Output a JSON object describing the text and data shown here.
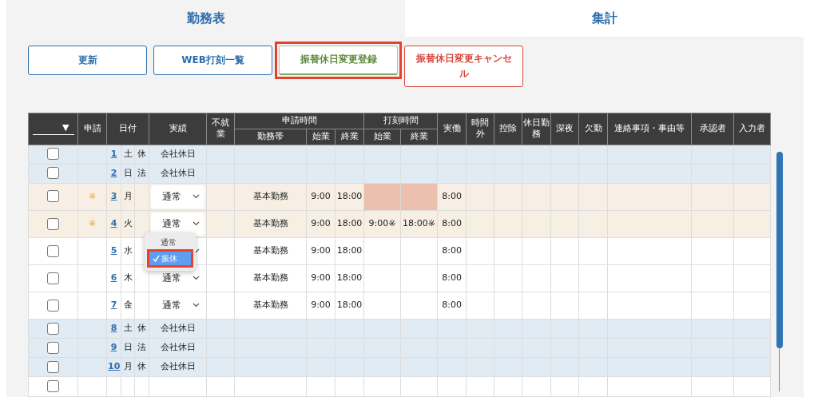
{
  "tabs": [
    {
      "label": "勤務表",
      "selected": true
    },
    {
      "label": "集計",
      "selected": false
    }
  ],
  "buttons": [
    {
      "label": "更新",
      "kind": "primary",
      "highlighted": false
    },
    {
      "label": "WEB打刻一覧",
      "kind": "primary",
      "highlighted": false
    },
    {
      "label": "振替休日変更登録",
      "kind": "success",
      "highlighted": true
    },
    {
      "label": "振替休日変更キャンセル",
      "kind": "danger",
      "highlighted": false
    }
  ],
  "table": {
    "select_all": "▼",
    "columns": [
      {
        "kind": "single",
        "label": "申請"
      },
      {
        "kind": "date",
        "label": "日付"
      },
      {
        "kind": "single",
        "label": "実績"
      },
      {
        "kind": "single",
        "label": "不就業"
      },
      {
        "kind": "group",
        "label": "申請時間",
        "children": [
          "勤務帯",
          "始業",
          "終業"
        ]
      },
      {
        "kind": "group",
        "label": "打刻時間",
        "children": [
          "始業",
          "終業"
        ]
      },
      {
        "kind": "single",
        "label": "実働"
      },
      {
        "kind": "single",
        "label": "時間外"
      },
      {
        "kind": "single",
        "label": "控除"
      },
      {
        "kind": "single",
        "label": "休日勤務"
      },
      {
        "kind": "single",
        "label": "深夜"
      },
      {
        "kind": "single",
        "label": "欠勤"
      },
      {
        "kind": "single",
        "label": "連絡事項・事由等"
      },
      {
        "kind": "single",
        "label": "承認者"
      },
      {
        "kind": "single",
        "label": "入力者"
      }
    ],
    "rows": [
      {
        "kind": "holiday",
        "checked": false,
        "day": "1",
        "weekday": "土",
        "holiday_type": "休",
        "result": "会社休日"
      },
      {
        "kind": "holiday",
        "checked": false,
        "day": "2",
        "weekday": "日",
        "holiday_type": "法",
        "result": "会社休日"
      },
      {
        "kind": "pending",
        "checked": false,
        "applied": "※",
        "day": "3",
        "weekday": "月",
        "editable": true,
        "result": "通常",
        "shift": "基本勤務",
        "start": "9:00",
        "end": "18:00",
        "punch_missing": true,
        "actual": "8:00"
      },
      {
        "kind": "pending",
        "checked": false,
        "applied": "※",
        "day": "4",
        "weekday": "火",
        "editable": true,
        "result": "通常",
        "shift": "基本勤務",
        "start": "9:00",
        "end": "18:00",
        "punch_start": "9:00※",
        "punch_end": "18:00※",
        "actual": "8:00",
        "dropdown": {
          "highlighted": true,
          "options": [
            {
              "label": "通常",
              "selected": false
            },
            {
              "label": "振休",
              "selected": true
            }
          ]
        }
      },
      {
        "kind": "normal",
        "checked": false,
        "day": "5",
        "weekday": "水",
        "editable": true,
        "shift": "基本勤務",
        "start": "9:00",
        "end": "18:00",
        "actual": "8:00"
      },
      {
        "kind": "normal",
        "checked": false,
        "day": "6",
        "weekday": "木",
        "editable": true,
        "result": "通常",
        "shift": "基本勤務",
        "start": "9:00",
        "end": "18:00",
        "actual": "8:00"
      },
      {
        "kind": "normal",
        "checked": false,
        "day": "7",
        "weekday": "金",
        "editable": true,
        "result": "通常",
        "shift": "基本勤務",
        "start": "9:00",
        "end": "18:00",
        "actual": "8:00"
      },
      {
        "kind": "holiday",
        "checked": false,
        "day": "8",
        "weekday": "土",
        "holiday_type": "休",
        "result": "会社休日"
      },
      {
        "kind": "holiday",
        "checked": false,
        "day": "9",
        "weekday": "日",
        "holiday_type": "法",
        "result": "会社休日"
      },
      {
        "kind": "holiday",
        "checked": false,
        "day": "10",
        "weekday": "月",
        "holiday_type": "休",
        "result": "会社休日"
      },
      {
        "kind": "cut",
        "checked": false
      }
    ]
  }
}
